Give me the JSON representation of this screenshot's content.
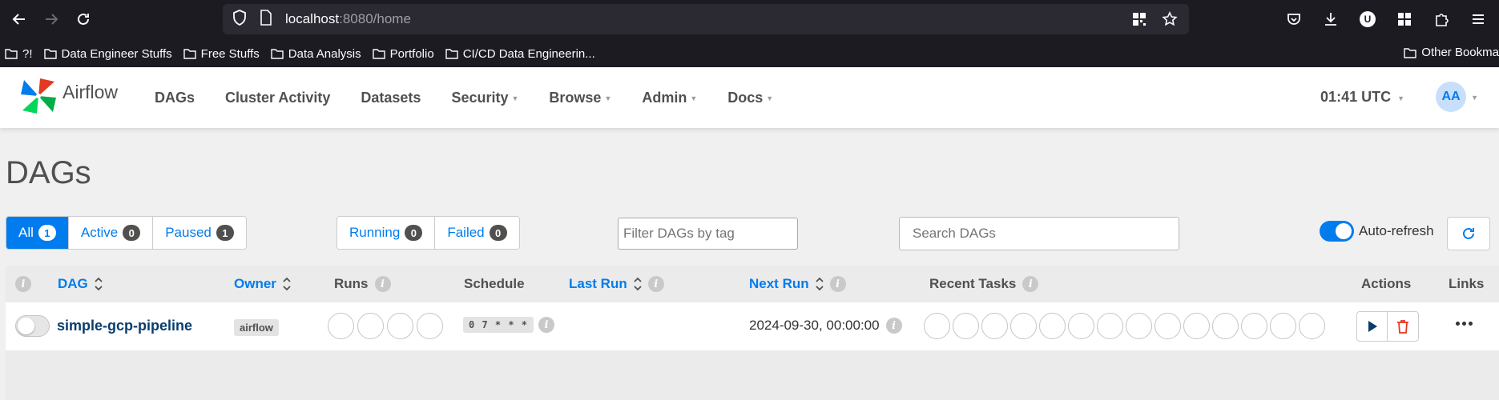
{
  "browser": {
    "url_host": "localhost",
    "url_rest": ":8080/home",
    "bookmarks": [
      "?!",
      "Data Engineer Stuffs",
      "Free Stuffs",
      "Data Analysis",
      "Portfolio",
      "CI/CD Data Engineerin..."
    ],
    "other_bookmarks": "Other Bookma",
    "profile_initial": "U"
  },
  "nav": {
    "brand": "Airflow",
    "menu": [
      "DAGs",
      "Cluster Activity",
      "Datasets",
      "Security",
      "Browse",
      "Admin",
      "Docs"
    ],
    "time": "01:41 UTC",
    "user_initials": "AA"
  },
  "page": {
    "title": "DAGs",
    "status_filters": [
      {
        "label": "All",
        "count": "1"
      },
      {
        "label": "Active",
        "count": "0"
      },
      {
        "label": "Paused",
        "count": "1"
      }
    ],
    "run_filters": [
      {
        "label": "Running",
        "count": "0"
      },
      {
        "label": "Failed",
        "count": "0"
      }
    ],
    "tag_filter_placeholder": "Filter DAGs by tag",
    "search_placeholder": "Search DAGs",
    "autorefresh_label": "Auto-refresh"
  },
  "table": {
    "headers": {
      "dag": "DAG",
      "owner": "Owner",
      "runs": "Runs",
      "schedule": "Schedule",
      "last_run": "Last Run",
      "next_run": "Next Run",
      "recent_tasks": "Recent Tasks",
      "actions": "Actions",
      "links": "Links"
    },
    "rows": [
      {
        "dag_id": "simple-gcp-pipeline",
        "owner": "airflow",
        "schedule": "0 7 * * *",
        "last_run": "",
        "next_run": "2024-09-30, 00:00:00"
      }
    ]
  },
  "colors": {
    "accent": "#017cee",
    "dag_link": "#0a3d6e",
    "delete": "#e43921"
  }
}
